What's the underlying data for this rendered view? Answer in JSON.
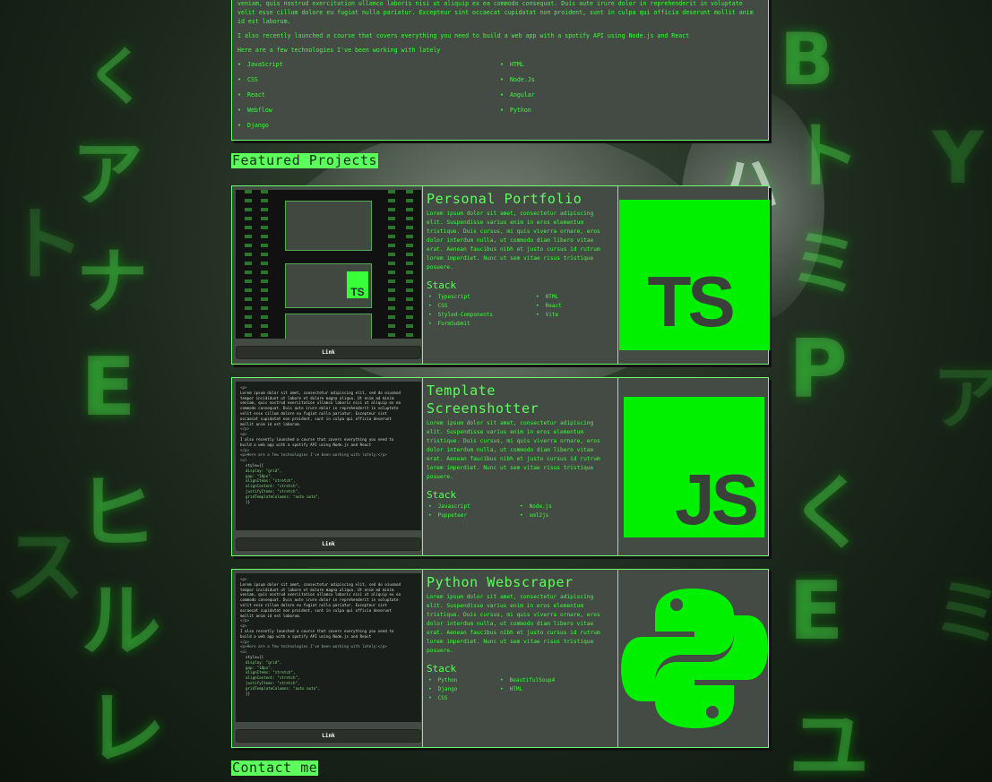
{
  "intro": {
    "paragraph1": "veniam, quis nostrud exercitation ullamco laboris nisi ut aliquip ex ea commodo consequat. Duis aute irure dolor in reprehenderit in voluptate velit esse cillum dolore eu fugiat nulla pariatur. Excepteur sint occaecat cupidatat non proident, sunt in culpa qui officia deserunt mollit anim id est laborum.",
    "paragraph2": "I also recently launched a course that covers everything you need to build a web app with a spotify API using Node.js and React",
    "paragraph3": "Here are a few technologies I've been working with lately",
    "technologies": [
      "JavaScript",
      "HTML",
      "CSS",
      "Node.Js",
      "React",
      "Angular",
      "Webflow",
      "Python",
      "Django"
    ]
  },
  "featured_title": "Featured Projects",
  "contact_title": "Contact me",
  "colors": {
    "accent": "#39ff39",
    "panel": "#444a44",
    "title_bg": "#5cff5c"
  },
  "projects": [
    {
      "title": "Personal Portfolio",
      "description": "Lorem ipsum dolor sit amet, consectetur adipiscing elit. Suspendisse varius enim in eros elementum tristique. Duis cursus, mi quis viverra ornare, eros dolor interdum nulla, ut commodo diam libero vitae erat. Aenean faucibus nibh et justo cursus id rutrum lorem imperdiet. Nunc ut sem vitae risus tristique posuere.",
      "stack_heading": "Stack",
      "stack": [
        "Typescript",
        "HTML",
        "CSS",
        "React",
        "Styled-Components",
        "Vite",
        "FormSubmit"
      ],
      "link_label": "Link",
      "logo_icon": "typescript-logo-icon",
      "logo_text": "TS"
    },
    {
      "title": "Template Screenshotter",
      "description": "Lorem ipsum dolor sit amet, consectetur adipiscing elit. Suspendisse varius enim in eros elementum tristique. Duis cursus, mi quis viverra ornare, eros dolor interdum nulla, ut commodo diam libero vitae erat. Aenean faucibus nibh et justo cursus id rutrum lorem imperdiet. Nunc ut sem vitae risus tristique posuere.",
      "stack_heading": "Stack",
      "stack": [
        "Javascript",
        "Node.js",
        "Puppeteer",
        "xml2js"
      ],
      "link_label": "Link",
      "logo_icon": "javascript-logo-icon",
      "logo_text": "JS"
    },
    {
      "title": "Python Webscraper",
      "description": "Lorem ipsum dolor sit amet, consectetur adipiscing elit. Suspendisse varius enim in eros elementum tristique. Duis cursus, mi quis viverra ornare, eros dolor interdum nulla, ut commodo diam libero vitae erat. Aenean faucibus nibh et justo cursus id rutrum lorem imperdiet. Nunc ut sem vitae risus tristique posuere.",
      "stack_heading": "Stack",
      "stack": [
        "Python",
        "BeautifulSoup4",
        "Django",
        "HTML",
        "CSS"
      ],
      "link_label": "Link",
      "logo_icon": "python-logo-icon"
    }
  ],
  "code_screenshot": {
    "lines": [
      "<p>",
      "Lorem ipsum dolor sit amet, consectetur adipiscing elit, sed do eiusmod",
      "tempor incididunt ut labore et dolore magna aliqua. Ut enim ad minim",
      "veniam, quis nostrud exercitation ullamco laboris nisi ut aliquip ex ea",
      "commodo consequat. Duis aute irure dolor in reprehenderit in voluptate",
      "velit esse cillum dolore eu fugiat nulla pariatur. Excepteur sint",
      "occaecat cupidatat non proident, sunt in culpa qui officia deserunt",
      "mollit anim id est laborum.",
      "</p>",
      "<p>",
      "I also recently launched a course that covers everything you need to",
      "build a web app with a spotify API using Node.js and React",
      "</p>",
      "<p>Here are a few technologies I've been working with lately:</p>",
      "<ul",
      "style={{",
      "display: \"grid\",",
      "gap: \"10px\",",
      "alignItems: \"stretch\",",
      "alignContent: \"stretch\",",
      "justifyItems: \"stretch\",",
      "gridTemplateColumns: \"auto auto\",",
      "}}"
    ]
  }
}
